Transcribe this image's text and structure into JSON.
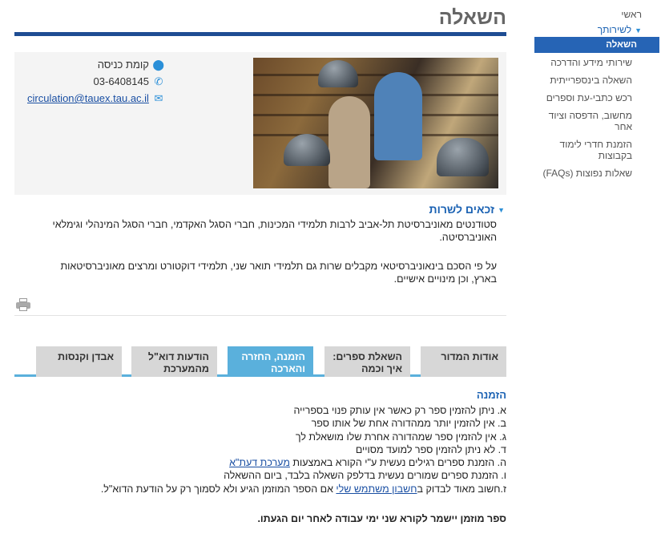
{
  "page": {
    "title": "השאלה"
  },
  "sidebar": {
    "home": "ראשי",
    "section": "לשירותך",
    "active": "השאלה",
    "items": [
      "שירותי מידע והדרכה",
      "השאלה בינספרייתית",
      "רכש כתבי-עת וספרים",
      "מחשוב, הדפסה וציוד אחר",
      "הזמנת חדרי לימוד בקבוצות",
      "שאלות נפוצות (FAQs)"
    ]
  },
  "contact": {
    "location": "קומת כניסה",
    "phone": "03-6408145",
    "email": "circulation@tauex.tau.ac.il",
    "icons": [
      "map-pin-icon",
      "phone-icon",
      "envelope-icon"
    ]
  },
  "rights": {
    "heading": "זכאים לשרות",
    "paragraph1": "סטודנטים מאוניברסיטת תל-אביב לרבות תלמידי המכינות, חברי הסגל האקדמי, חברי הסגל המינהלי וגימלאי האוניברסיטה.",
    "paragraph2": "על פי הסכם בינאוניברסיטאי מקבלים שרות גם תלמידי תואר שני, תלמידי דוקטורט ומרצים מאוניברסיטאות בארץ, וכן מינויים אישיים."
  },
  "tabs": [
    {
      "label": "אודות המדור",
      "active": false
    },
    {
      "label": "השאלת ספרים: איך וכמה",
      "active": false
    },
    {
      "label": "הזמנה, החזרה והארכה",
      "active": true
    },
    {
      "label": "הודעות דוא\"ל מהמערכת",
      "active": false
    },
    {
      "label": "אבדן וקנסות",
      "active": false
    }
  ],
  "content": {
    "heading": "הזמנה",
    "items": {
      "a": "א. ניתן להזמין ספר רק כאשר אין עותק פנוי בספרייה",
      "b": "ב. אין להזמין יותר ממהדורה אחת של אותו ספר",
      "c": "ג. אין להזמין ספר שמהדורה אחרת שלו מושאלת לך",
      "d": "ד. לא ניתן להזמין ספר למועד מסויים",
      "e_prefix": "ה. הזמנת ספרים רגילים נעשית ע\"י הקורא באמצעות ",
      "e_link": "מערכת דעת\"א",
      "f": "ו. הזמנת ספרים שמורים נעשית בדלפק השאלה בלבד, ביום ההשאלה",
      "g_prefix": "ז.חשוב מאוד לבדוק ב",
      "g_link": "חשבון משתמש שלי",
      "g_suffix": " אם הספר המוזמן הגיע ולא לסמוך רק על הודעת הדוא\"ל."
    },
    "note": "ספר מוזמן יישמר לקורא שני ימי עבודה לאחר יום הגעתו."
  }
}
